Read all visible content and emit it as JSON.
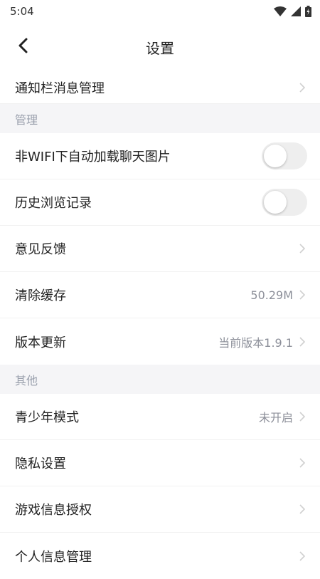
{
  "status_bar": {
    "time": "5:04",
    "icons": [
      "wifi-icon",
      "signal-icon",
      "battery-icon"
    ]
  },
  "header": {
    "title": "设置",
    "back_icon": "chevron-left-icon"
  },
  "top_item": {
    "label": "通知栏消息管理"
  },
  "sections": {
    "manage": "管理",
    "other": "其他"
  },
  "manage_items": {
    "non_wifi_images": {
      "label": "非WIFI下自动加载聊天图片",
      "toggle_on": false
    },
    "browse_history": {
      "label": "历史浏览记录",
      "toggle_on": false
    },
    "feedback": {
      "label": "意见反馈"
    },
    "clear_cache": {
      "label": "清除缓存",
      "value": "50.29M"
    },
    "version_update": {
      "label": "版本更新",
      "value": "当前版本1.9.1"
    }
  },
  "other_items": {
    "teen_mode": {
      "label": "青少年模式",
      "value": "未开启"
    },
    "privacy": {
      "label": "隐私设置"
    },
    "game_auth": {
      "label": "游戏信息授权"
    },
    "personal_info": {
      "label": "个人信息管理"
    }
  },
  "colors": {
    "section_bg": "#f5f5f7",
    "section_text": "#9aa0ad",
    "value_text": "#8c8f99",
    "toggle_off": "#eeeeee"
  }
}
